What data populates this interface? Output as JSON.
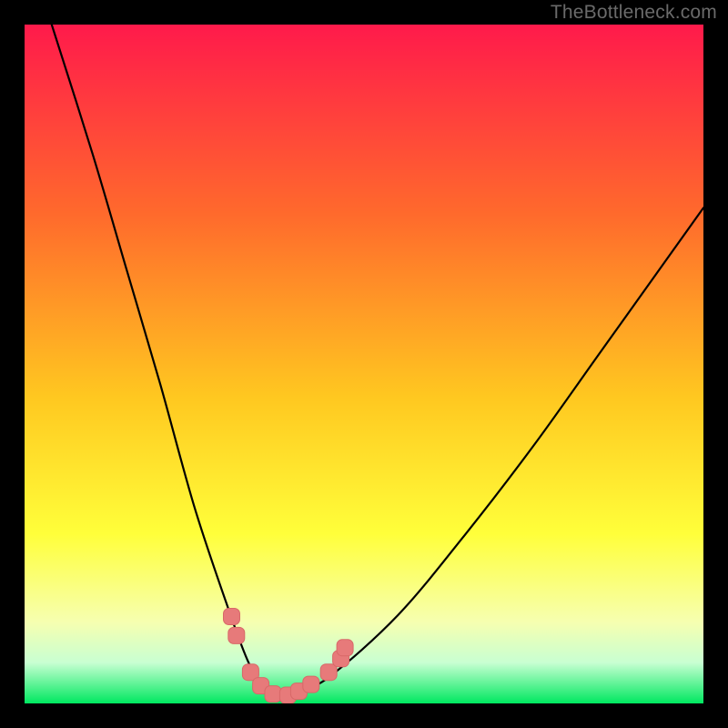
{
  "watermark": "TheBottleneck.com",
  "colors": {
    "black": "#000000",
    "grad_top": "#ff1a4b",
    "grad_mid1": "#ff6a2c",
    "grad_mid2": "#ffc820",
    "grad_mid3": "#ffff3a",
    "grad_mid4": "#f6ffb0",
    "grad_mid5": "#c8ffd2",
    "grad_bottom": "#00e860",
    "curve": "#000000",
    "marker_fill": "#e77a7a",
    "marker_stroke": "#d86868"
  },
  "chart_data": {
    "type": "line",
    "title": "",
    "xlabel": "",
    "ylabel": "",
    "xlim": [
      0,
      100
    ],
    "ylim": [
      0,
      100
    ],
    "series": [
      {
        "name": "bottleneck-curve",
        "x": [
          4,
          10,
          15,
          20,
          25,
          30,
          33,
          35,
          37,
          39,
          40,
          45,
          55,
          65,
          75,
          85,
          95,
          100
        ],
        "y": [
          100,
          81,
          64,
          47,
          29,
          14,
          6,
          3,
          1,
          1,
          1.5,
          4,
          13,
          25,
          38,
          52,
          66,
          73
        ]
      }
    ],
    "markers": [
      {
        "x": 30.5,
        "y": 12.8
      },
      {
        "x": 31.2,
        "y": 10.0
      },
      {
        "x": 33.3,
        "y": 4.6
      },
      {
        "x": 34.8,
        "y": 2.6
      },
      {
        "x": 36.6,
        "y": 1.4
      },
      {
        "x": 38.8,
        "y": 1.2
      },
      {
        "x": 40.4,
        "y": 1.8
      },
      {
        "x": 42.2,
        "y": 2.8
      },
      {
        "x": 44.8,
        "y": 4.6
      },
      {
        "x": 46.6,
        "y": 6.6
      },
      {
        "x": 47.2,
        "y": 8.2
      }
    ]
  }
}
